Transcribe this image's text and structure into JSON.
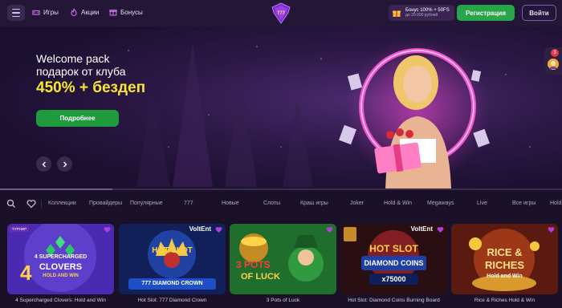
{
  "header": {
    "nav": [
      {
        "label": "Игры",
        "icon": "gamepad-icon"
      },
      {
        "label": "Акции",
        "icon": "flame-icon"
      },
      {
        "label": "Бонусы",
        "icon": "gift-icon"
      }
    ],
    "logo_text": "777",
    "bonus_line1": "Бонус 100% + 50FS",
    "bonus_line2": "до 20 000 рублей",
    "register_label": "Регистрация",
    "login_label": "Войти"
  },
  "banner": {
    "title": "Welcome pack",
    "subtitle": "подарок от клуба",
    "offer": "450% + бездеп",
    "cta_label": "Подробнее",
    "progress": 0.2,
    "side_badge": "3"
  },
  "categories": [
    "Коллекции",
    "Провайдеры",
    "Популярные",
    "777",
    "Новые",
    "Слоты",
    "Краш игры",
    "Joker",
    "Hold & Win",
    "Megaways",
    "Live",
    "Все игры",
    "Hold"
  ],
  "games": [
    {
      "title": "4 Supercharged Clovers: Hold and Win",
      "provider": "",
      "tag": "ТУРНИР",
      "art": [
        "4 SUPERCHARGED",
        "CLOVERS",
        "HOLD AND WIN"
      ]
    },
    {
      "title": "Hot Slot: 777 Diamond Crown",
      "provider": "VoltEnt",
      "tag": "",
      "art": [
        "HOT SLOT",
        "777 DIAMOND CROWN"
      ]
    },
    {
      "title": "3 Pots of Luck",
      "provider": "",
      "tag": "",
      "art": [
        "3 POTS",
        "OF LUCK"
      ]
    },
    {
      "title": "Hot Slot: Diamond Coins Burning Board",
      "provider": "VoltEnt",
      "tag": "",
      "art": [
        "HOT SLOT",
        "DIAMOND COINS",
        "x75000"
      ]
    },
    {
      "title": "Rice & Riches Hold & Win",
      "provider": "",
      "tag": "",
      "art": [
        "RICE &",
        "RICHES",
        "Hold and Win"
      ]
    }
  ],
  "colors": {
    "header_bg": "#241636",
    "register": "#27a548",
    "offer": "#f6e636",
    "accent": "#b13fd9"
  }
}
